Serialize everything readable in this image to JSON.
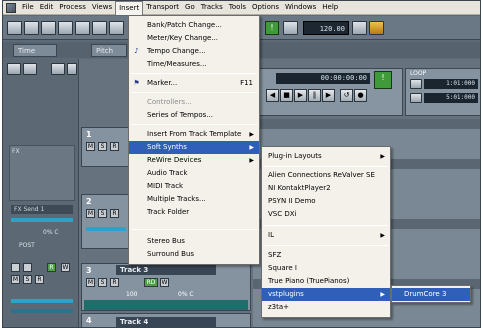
{
  "menubar": {
    "items": [
      "File",
      "Edit",
      "Process",
      "Views",
      "Insert",
      "Transport",
      "Go",
      "Tracks",
      "Tools",
      "Options",
      "Windows",
      "Help"
    ],
    "active": "Insert"
  },
  "toolbar": {
    "tempo": "120.00"
  },
  "tabs": {
    "time": "Time",
    "pitch": "Pitch"
  },
  "transport": {
    "time": "00:00:00:00",
    "title": "1:01:000"
  },
  "loop": {
    "label": "LOOP",
    "start": "1:01:000",
    "end": "5:01:000"
  },
  "left_panel": {
    "fx_label": "FX",
    "send": "FX Send 1",
    "pan_pct": "0% C",
    "post": "POST"
  },
  "tracks": [
    {
      "num": "1",
      "name": "",
      "pct": ""
    },
    {
      "num": "2",
      "name": "",
      "pct": ""
    },
    {
      "num": "3",
      "name": "Track 3",
      "level": "100",
      "pct": "0% C"
    },
    {
      "num": "4",
      "name": "Track 4"
    }
  ],
  "insert_menu": {
    "items": [
      {
        "label": "Bank/Patch Change..."
      },
      {
        "label": "Meter/Key Change..."
      },
      {
        "label": "Tempo Change..."
      },
      {
        "label": "Time/Measures..."
      },
      {
        "label": "Marker...",
        "shortcut": "F11"
      },
      {
        "label": "Controllers..."
      },
      {
        "label": "Series of Tempos..."
      },
      {
        "label": "Insert From Track Template"
      },
      {
        "label": "Soft Synths"
      },
      {
        "label": "ReWire Devices"
      },
      {
        "label": "Audio Track"
      },
      {
        "label": "MIDI Track"
      },
      {
        "label": "Multiple Tracks..."
      },
      {
        "label": "Track Folder"
      },
      {
        "label": "Stereo Bus"
      },
      {
        "label": "Surround Bus"
      }
    ]
  },
  "softsynth_menu": {
    "items": [
      {
        "label": "Plug-in Layouts"
      },
      {
        "label": "Alien Connections ReValver SE"
      },
      {
        "label": "NI KontaktPlayer2"
      },
      {
        "label": "PSYN II Demo"
      },
      {
        "label": "VSC DXi"
      },
      {
        "label": "IL"
      },
      {
        "label": "SFZ"
      },
      {
        "label": "Square I"
      },
      {
        "label": "True Piano (TruePianos)"
      },
      {
        "label": "vstplugins"
      },
      {
        "label": "z3ta+"
      }
    ]
  },
  "vst_menu": {
    "items": [
      {
        "label": "DrumCore 3"
      }
    ]
  },
  "colors": {
    "highlight": "#2f5fb8",
    "menu_bg": "#f3f1ea",
    "app_bg": "#5d6b78"
  }
}
